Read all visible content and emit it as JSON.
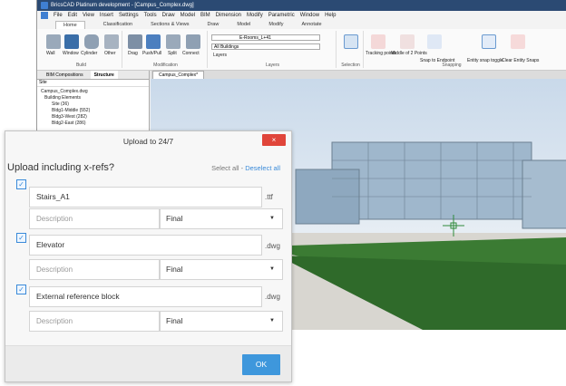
{
  "window": {
    "title": "BricsCAD Platinum development - [Campus_Complex.dwg]"
  },
  "menu": [
    "File",
    "Edit",
    "View",
    "Insert",
    "Settings",
    "Tools",
    "Draw",
    "Model",
    "BIM",
    "Dimension",
    "Modify",
    "Parametric",
    "Window",
    "Help"
  ],
  "ribbon_tabs": [
    "Home",
    "Classification",
    "Sections & Views",
    "Draw",
    "Model",
    "Modify",
    "Annotate"
  ],
  "ribbon": {
    "build_buttons": [
      "Wall",
      "Window",
      "Cylinder",
      "Other"
    ],
    "modification_buttons": [
      "Drag",
      "Push/Pull",
      "Split",
      "Connect"
    ],
    "layers_label": "Layers",
    "layer_combo": "E-Rooms_L+41",
    "building_combo": "All Buildings",
    "snapping_buttons": [
      "Tracking points",
      "Middle of 2 Points",
      "Snap to Endpoint",
      "Entity snap toggle",
      "Clear Entity Snaps"
    ],
    "groups": [
      "Build",
      "Modification",
      "Layers",
      "Selection",
      "Snapping"
    ]
  },
  "panel": {
    "tabs": [
      "BIM Compositions",
      "Structure"
    ],
    "site_label": "Site",
    "tree": [
      "Campus_Complex.dwg",
      "Building Elements",
      "Site (36)",
      "Bldg1-Middle (552)",
      "Bldg3-West (282)",
      "Bldg2-East (286)"
    ]
  },
  "document_tab": "Campus_Complex*",
  "dialog": {
    "title": "Upload to 24/7",
    "close_label": "×",
    "heading": "Upload including x-refs?",
    "select_all": "Select all",
    "separator": " - ",
    "deselect_all": "Deselect all",
    "items": [
      {
        "name": "Stairs_A1",
        "extension": ".ttf",
        "description_placeholder": "Description",
        "status": "Final"
      },
      {
        "name": "Elevator",
        "extension": ".dwg",
        "description_placeholder": "Description",
        "status": "Final"
      },
      {
        "name": "External reference block",
        "extension": ".dwg",
        "description_placeholder": "Description",
        "status": "Final"
      }
    ],
    "ok_label": "OK"
  },
  "colors": {
    "accent": "#3e97dc",
    "close": "#e0453a",
    "titlebar": "#2b4a73"
  }
}
